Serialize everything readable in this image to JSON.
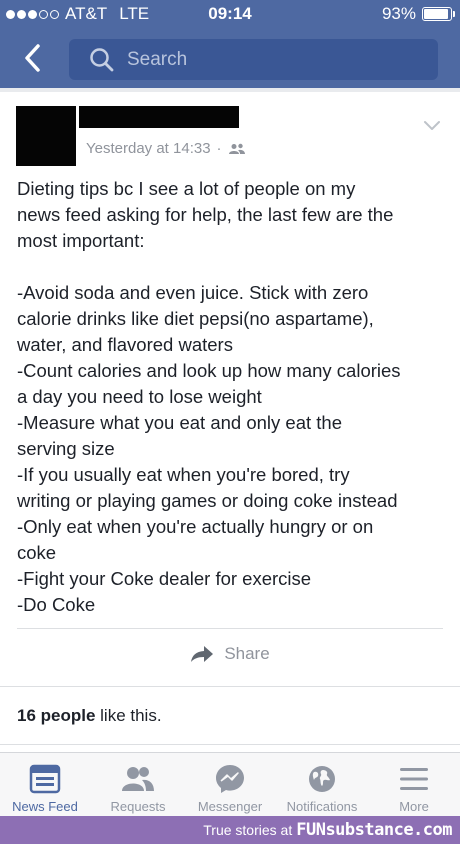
{
  "status_bar": {
    "carrier": "AT&T",
    "network": "LTE",
    "time": "09:14",
    "battery_text": "93%",
    "battery_level": 0.93,
    "signal_bars_filled": 3,
    "signal_bars_total": 5
  },
  "nav": {
    "search_placeholder": "Search"
  },
  "post": {
    "timestamp": "Yesterday at 14:33",
    "meta_separator": "·",
    "lines": [
      "Dieting tips bc I see a lot of people on my",
      "news feed asking for help, the last few are the",
      "most important:",
      "",
      "-Avoid soda and even juice. Stick with zero",
      "calorie drinks like diet pepsi(no aspartame),",
      "water, and flavored waters",
      "-Count calories and look up how many calories",
      "a day you need to lose weight",
      "-Measure what you eat and only eat the",
      "serving size",
      "-If you usually eat when you're bored, try",
      "writing or playing games or doing coke instead",
      "-Only eat when you're actually hungry or on",
      "coke",
      "-Fight your Coke dealer for exercise",
      "-Do Coke"
    ],
    "share_label": "Share",
    "likes_count": "16 people",
    "likes_suffix": " like this."
  },
  "tabs": [
    {
      "label": "News Feed",
      "icon": "news-feed-icon",
      "active": true
    },
    {
      "label": "Requests",
      "icon": "friend-requests-icon",
      "active": false
    },
    {
      "label": "Messenger",
      "icon": "messenger-icon",
      "active": false
    },
    {
      "label": "Notifications",
      "icon": "globe-icon",
      "active": false
    },
    {
      "label": "More",
      "icon": "menu-icon",
      "active": false
    }
  ],
  "watermark": {
    "text": "True stories at",
    "brand": "FUNsubstance.com"
  },
  "colors": {
    "brand_blue": "#4e69a2",
    "search_bg": "#3a5795",
    "muted_text": "#90949c",
    "watermark_bg": "#8d6fb4"
  }
}
